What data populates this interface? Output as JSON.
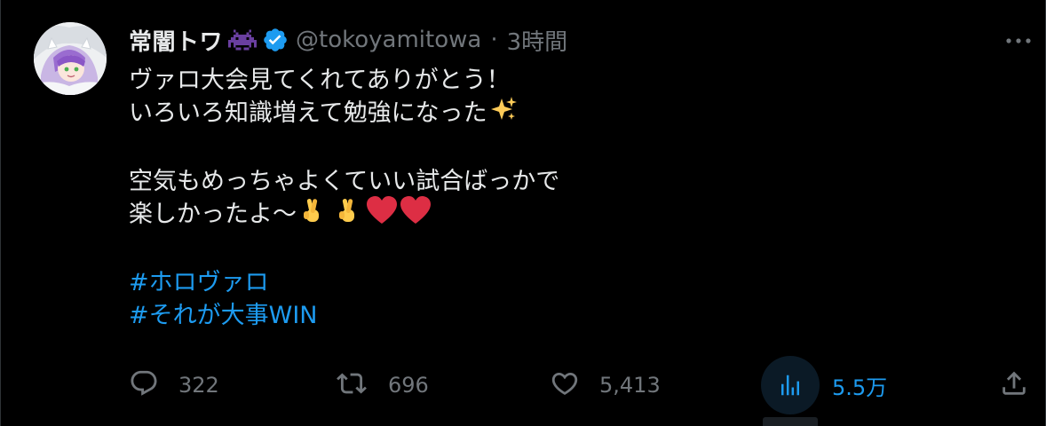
{
  "tweet": {
    "display_name": "常闇トワ",
    "handle": "@tokoyamitowa",
    "separator": "·",
    "time": "3時間",
    "lines": {
      "l1": "ヴァロ大会見てくれてありがとう！",
      "l2": "いろいろ知識増えて勉強になった",
      "l3": "空気もめっちゃよくていい試合ばっかで",
      "l4": "楽しかったよ〜"
    },
    "hashtags": [
      "#ホロヴァロ",
      "#それが大事WIN"
    ],
    "emojis": {
      "sparkles": "sparkles-icon",
      "hearts": "heart-icon",
      "fingers": "crossed-fingers-icon"
    }
  },
  "actions": {
    "reply_count": "322",
    "retweet_count": "696",
    "like_count": "5,413",
    "views_count": "5.5万"
  },
  "colors": {
    "background": "#000000",
    "text": "#e7e9ea",
    "muted": "#71767b",
    "accent": "#1d9bf0",
    "verified": "#1d9bf0",
    "heart": "#e0245e",
    "invader": "#6a3fa0"
  }
}
